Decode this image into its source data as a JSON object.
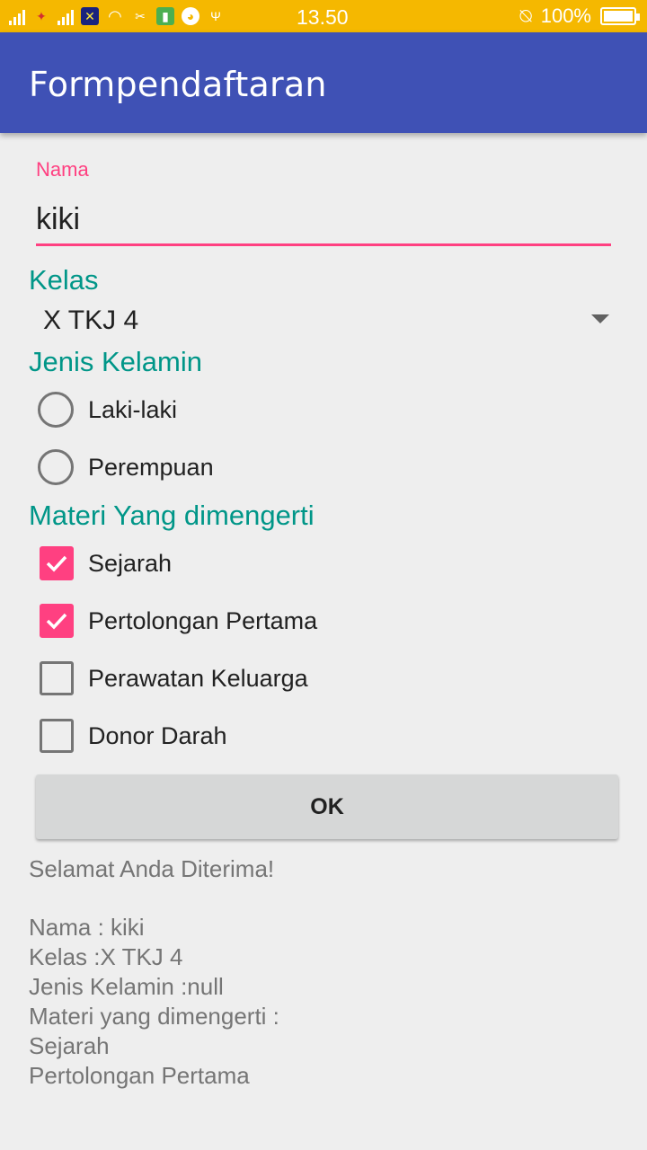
{
  "status_bar": {
    "time": "13.50",
    "battery": "100%",
    "icons": [
      "signal-icon",
      "signal-icon",
      "sim-icon",
      "wifi-icon",
      "usb-debug-icon",
      "battery-small-icon",
      "android-icon",
      "usb-icon",
      "alarm-off-icon",
      "battery-icon"
    ]
  },
  "app_bar": {
    "title": "Formpendaftaran"
  },
  "form": {
    "name_label": "Nama",
    "name_value": "kiki",
    "kelas_label": "Kelas",
    "kelas_value": "X TKJ 4",
    "gender_label": "Jenis Kelamin",
    "gender_options": [
      {
        "label": "Laki-laki",
        "selected": false
      },
      {
        "label": "Perempuan",
        "selected": false
      }
    ],
    "materi_label": "Materi Yang dimengerti",
    "materi_options": [
      {
        "label": "Sejarah",
        "checked": true
      },
      {
        "label": "Pertolongan Pertama",
        "checked": true
      },
      {
        "label": "Perawatan Keluarga",
        "checked": false
      },
      {
        "label": "Donor Darah",
        "checked": false
      }
    ],
    "ok_label": "OK"
  },
  "result": {
    "greeting": "Selamat Anda Diterima!",
    "lines": [
      "Nama : kiki",
      "Kelas :X TKJ 4",
      "Jenis Kelamin :null",
      "Materi yang dimengerti :",
      "Sejarah",
      "Pertolongan Pertama"
    ]
  },
  "colors": {
    "status_bar": "#f5b800",
    "app_bar": "#3f51b5",
    "accent": "#ff4081",
    "section_label": "#009688"
  }
}
